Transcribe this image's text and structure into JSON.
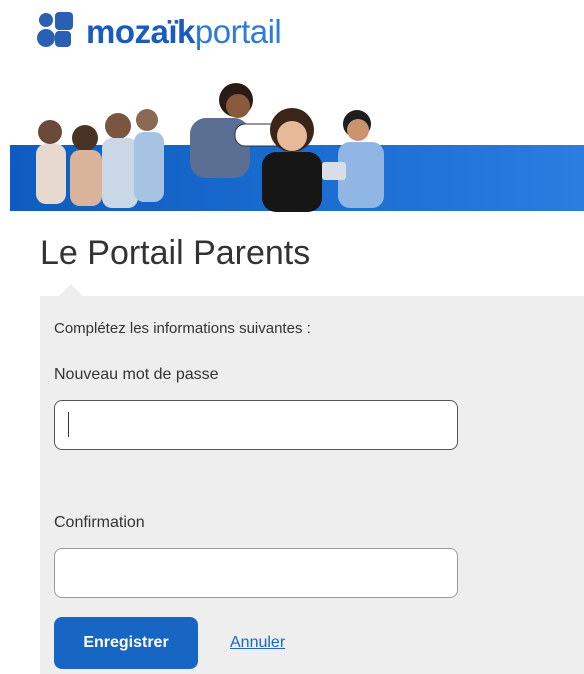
{
  "brand": {
    "bold": "mozaïk",
    "light": "portail"
  },
  "page": {
    "title": "Le Portail Parents"
  },
  "form": {
    "instructions": "Complétez les informations suivantes :",
    "new_password_label": "Nouveau mot de passe",
    "new_password_value": "",
    "confirmation_label": "Confirmation",
    "confirmation_value": "",
    "save_label": "Enregistrer",
    "cancel_label": "Annuler"
  },
  "colors": {
    "brand_blue": "#1766c3",
    "panel_bg": "#eeeeee"
  }
}
